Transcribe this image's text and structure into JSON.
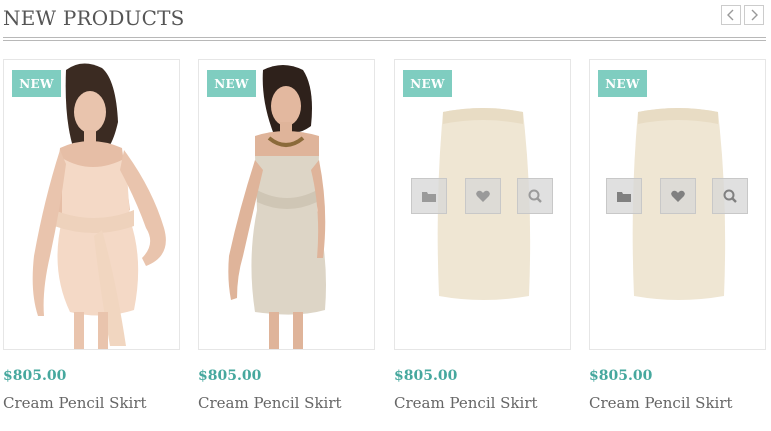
{
  "section": {
    "title": "NEW PRODUCTS"
  },
  "nav": {
    "prev_icon": "chevron-left-icon",
    "next_icon": "chevron-right-icon"
  },
  "colors": {
    "badge": "#7fcdc0",
    "price": "#46a89e",
    "text": "#555555"
  },
  "products": [
    {
      "badge": "NEW",
      "price": "$805.00",
      "name": "Cream Pencil Skirt",
      "image": "woman-lace-wrap-dress"
    },
    {
      "badge": "NEW",
      "price": "$805.00",
      "name": "Cream Pencil Skirt",
      "image": "woman-strapless-metallic-dress"
    },
    {
      "badge": "NEW",
      "price": "$805.00",
      "name": "Cream Pencil Skirt",
      "image": "cream-pencil-skirt",
      "actions": [
        "folder-icon",
        "heart-icon",
        "search-icon"
      ]
    },
    {
      "badge": "NEW",
      "price": "$805.00",
      "name": "Cream Pencil Skirt",
      "image": "cream-pencil-skirt",
      "actions": [
        "folder-icon",
        "heart-icon",
        "search-icon"
      ]
    }
  ]
}
